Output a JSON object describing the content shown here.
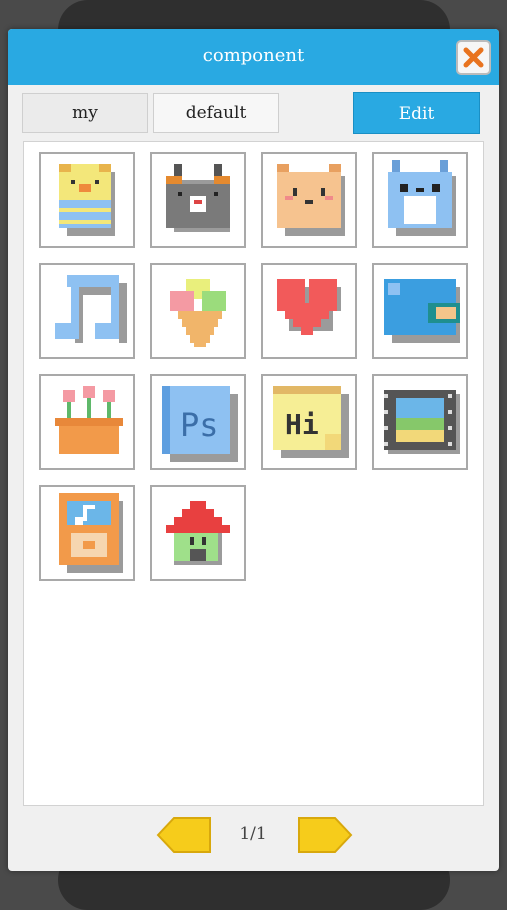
{
  "dialog": {
    "title": "component",
    "close_icon": "close-x-icon"
  },
  "tabs": [
    {
      "label": "my"
    },
    {
      "label": "default"
    }
  ],
  "edit_label": "Edit",
  "components": [
    {
      "name": "chick-striped-sweater-icon"
    },
    {
      "name": "gray-mouse-icon"
    },
    {
      "name": "orange-bear-icon"
    },
    {
      "name": "blue-totoro-icon"
    },
    {
      "name": "music-note-icon"
    },
    {
      "name": "ice-cream-cone-icon"
    },
    {
      "name": "heart-icon"
    },
    {
      "name": "blue-wallet-icon"
    },
    {
      "name": "flower-pot-icon"
    },
    {
      "name": "photoshop-book-icon"
    },
    {
      "name": "hi-sticky-note-icon"
    },
    {
      "name": "film-strip-icon"
    },
    {
      "name": "orange-music-player-icon"
    },
    {
      "name": "house-icon"
    }
  ],
  "pagination": {
    "text": "1/1",
    "prev_icon": "arrow-left-icon",
    "next_icon": "arrow-right-icon"
  },
  "colors": {
    "accent": "#29a9e2",
    "close": "#e8731f",
    "pager": "#f6cc1b"
  }
}
